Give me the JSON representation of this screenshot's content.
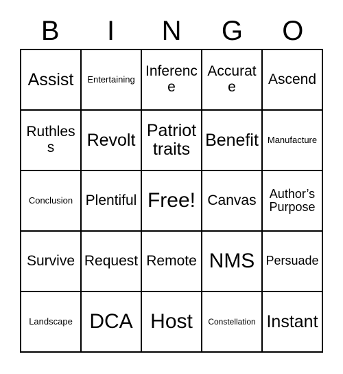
{
  "card": {
    "title": "BINGO",
    "header_letters": [
      "B",
      "I",
      "N",
      "G",
      "O"
    ],
    "grid_size": "5x5",
    "free_space": "Free!",
    "colors": {
      "background": "#ffffff",
      "border": "#000000",
      "text": "#000000"
    },
    "cells": [
      [
        {
          "text": "Assist",
          "size": "lg"
        },
        {
          "text": "Entertaining",
          "size": "xs"
        },
        {
          "text": "Inference",
          "size": "md"
        },
        {
          "text": "Accurate",
          "size": "md"
        },
        {
          "text": "Ascend",
          "size": "md"
        }
      ],
      [
        {
          "text": "Ruthless",
          "size": "md"
        },
        {
          "text": "Revolt",
          "size": "lg"
        },
        {
          "text": "Patriot\ntraits",
          "size": "lg"
        },
        {
          "text": "Benefit",
          "size": "lg"
        },
        {
          "text": "Manufacture",
          "size": "xs"
        }
      ],
      [
        {
          "text": "Conclusion",
          "size": "xs"
        },
        {
          "text": "Plentiful",
          "size": "md"
        },
        {
          "text": "Free!",
          "size": "xl"
        },
        {
          "text": "Canvas",
          "size": "md"
        },
        {
          "text": "Author’s\nPurpose",
          "size": "sm"
        }
      ],
      [
        {
          "text": "Survive",
          "size": "md"
        },
        {
          "text": "Request",
          "size": "md"
        },
        {
          "text": "Remote",
          "size": "md"
        },
        {
          "text": "NMS",
          "size": "xl"
        },
        {
          "text": "Persuade",
          "size": "sm"
        }
      ],
      [
        {
          "text": "Landscape",
          "size": "xs"
        },
        {
          "text": "DCA",
          "size": "xl"
        },
        {
          "text": "Host",
          "size": "xl"
        },
        {
          "text": "Constellation",
          "size": "xxs"
        },
        {
          "text": "Instant",
          "size": "lg"
        }
      ]
    ]
  }
}
